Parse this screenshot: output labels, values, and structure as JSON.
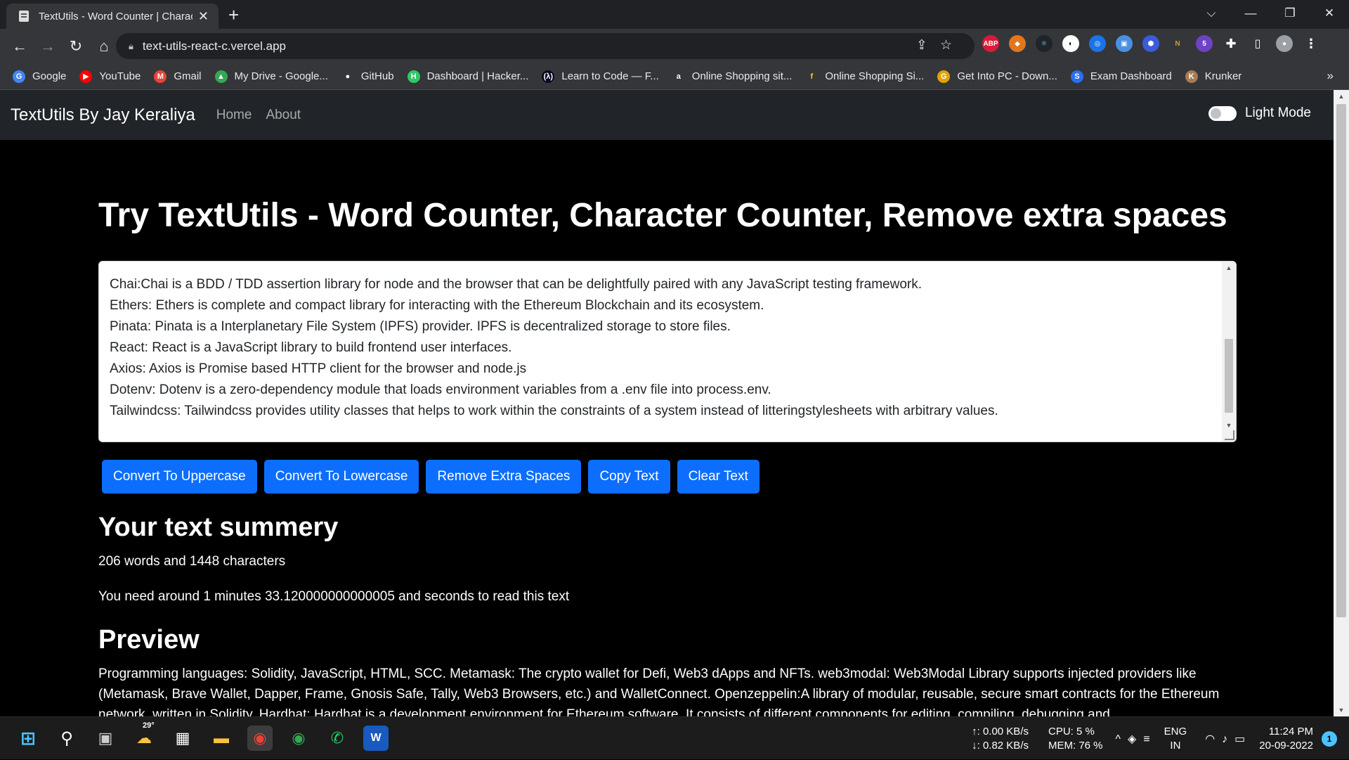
{
  "browser": {
    "tab_title": "TextUtils - Word Counter | Charact",
    "url": "text-utils-react-c.vercel.app",
    "bookmarks": [
      {
        "label": "Google",
        "icon": "G",
        "color": "#4285f4"
      },
      {
        "label": "YouTube",
        "icon": "▶",
        "color": "#ff0000"
      },
      {
        "label": "Gmail",
        "icon": "M",
        "color": "#ea4335"
      },
      {
        "label": "My Drive - Google...",
        "icon": "▲",
        "color": "#34a853"
      },
      {
        "label": "GitHub",
        "icon": "●",
        "color": "#ffffff"
      },
      {
        "label": "Dashboard | Hacker...",
        "icon": "H",
        "color": "#2ec866"
      },
      {
        "label": "Learn to Code — F...",
        "icon": "(λ)",
        "color": "#0a0a23"
      },
      {
        "label": "Online Shopping sit...",
        "icon": "a",
        "color": "#ffffff"
      },
      {
        "label": "Online Shopping Si...",
        "icon": "f",
        "color": "#f8d100"
      },
      {
        "label": "Get Into PC - Down...",
        "icon": "G",
        "color": "#e0a400"
      },
      {
        "label": "Exam Dashboard",
        "icon": "S",
        "color": "#2a6ff3"
      },
      {
        "label": "Krunker",
        "icon": "K",
        "color": "#a67c52"
      }
    ],
    "more_label": "»"
  },
  "app": {
    "brand": "TextUtils By Jay Keraliya",
    "nav": {
      "home": "Home",
      "about": "About"
    },
    "mode_label": "Light Mode",
    "title": "Try TextUtils - Word Counter, Character Counter, Remove extra spaces",
    "textarea_lines": [
      "Chai:Chai is a BDD / TDD assertion library for node and the browser that can be delightfully paired with any JavaScript testing framework.",
      "Ethers: Ethers is complete and compact library for interacting with the Ethereum Blockchain and its ecosystem.",
      "Pinata: Pinata is a Interplanetary File System (IPFS) provider. IPFS is decentralized storage to store files.",
      "React: React is a JavaScript library to build frontend user interfaces.",
      "Axios: Axios is Promise based HTTP client for the browser and node.js",
      "Dotenv: Dotenv is a zero-dependency module that loads environment variables from a .env file into process.env.",
      "Tailwindcss: Tailwindcss provides utility classes that helps to work within the constraints of a system instead of litteringstylesheets with arbitrary values."
    ],
    "buttons": {
      "uppercase": "Convert To Uppercase",
      "lowercase": "Convert To Lowercase",
      "extra_spaces": "Remove Extra Spaces",
      "copy": "Copy Text",
      "clear": "Clear Text"
    },
    "summary_title": "Your text summery",
    "summary_counts": "206 words and 1448 characters",
    "summary_read": "You need around 1 minutes 33.120000000000005 and seconds to read this text",
    "preview_title": "Preview",
    "preview_text": "Programming languages: Solidity, JavaScript, HTML, SCC. Metamask: The crypto wallet for Defi, Web3 dApps and NFTs. web3modal: Web3Modal Library supports injected providers like (Metamask, Brave Wallet, Dapper, Frame, Gnosis Safe, Tally, Web3 Browsers, etc.) and WalletConnect. Openzeppelin:A library of modular, reusable, secure smart contracts for the Ethereum network, written in Solidity. Hardhat: Hardhat is a development environment for Ethereum software. It consists of different components for editing, compiling, debugging and"
  },
  "taskbar": {
    "weather": "29°",
    "net_up": "↑: 0.00 KB/s",
    "net_down": "↓: 0.82 KB/s",
    "cpu": "CPU: 5 %",
    "mem": "MEM: 76 %",
    "lang1": "ENG",
    "lang2": "IN",
    "time": "11:24 PM",
    "date": "20-09-2022",
    "notif_count": "1"
  }
}
